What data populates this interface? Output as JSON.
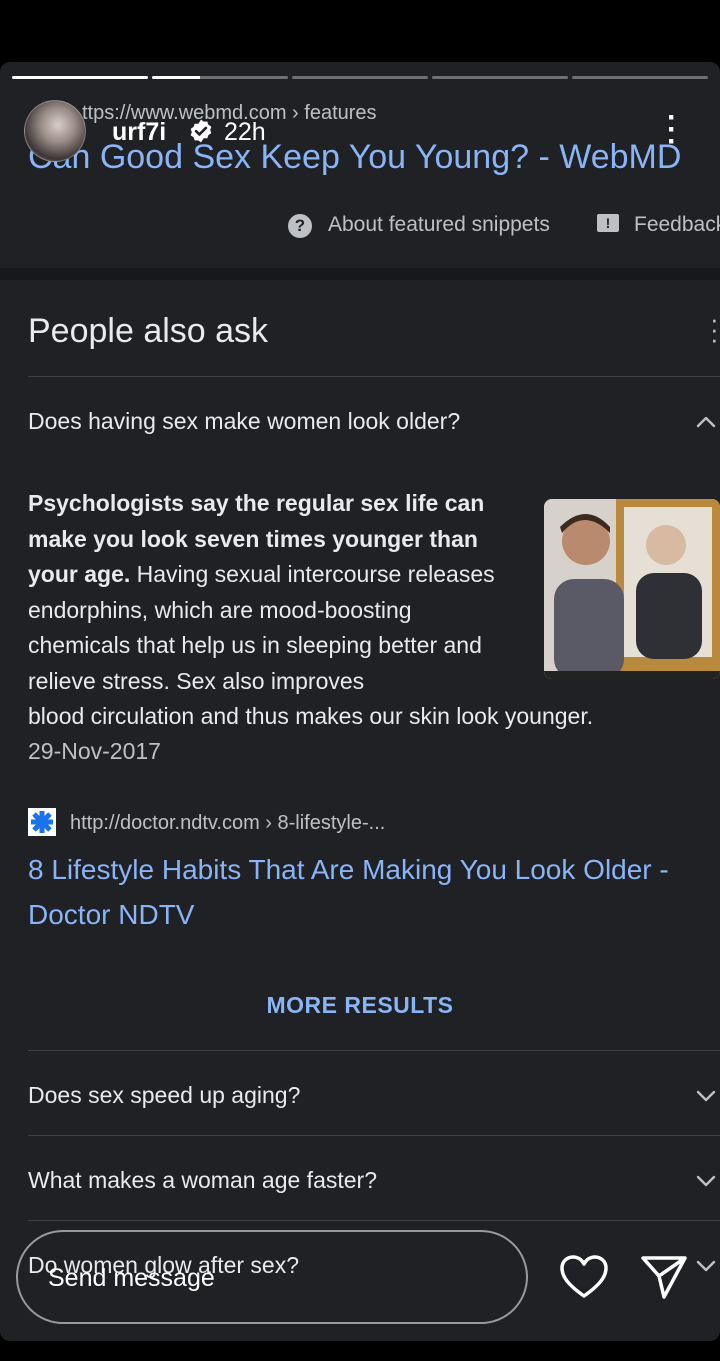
{
  "story": {
    "username": "urf7i",
    "time_ago": "22h",
    "progress": [
      1.0,
      0.35,
      0.0,
      0.0,
      0.0
    ],
    "reply_placeholder": "Send message"
  },
  "search": {
    "result_url": "ttps://www.webmd.com › features",
    "result_title": "Can Good Sex Keep You Young? - WebMD",
    "about_snippets": "About featured snippets",
    "feedback": "Feedback"
  },
  "paa": {
    "title": "People also ask",
    "expanded": {
      "question": "Does having sex make women look older?",
      "answer_bold": "Psychologists say the regular sex life can make you look seven times younger than your age.",
      "answer_rest": " Having sexual intercourse releases endorphins, which are mood-boosting chemicals that help us in sleeping better and relieve stress. Sex also improves",
      "answer_tail": "blood circulation and thus makes our skin look younger.",
      "date": "29-Nov-2017",
      "source_url": "http://doctor.ndtv.com › 8-lifestyle-...",
      "source_title": "8 Lifestyle Habits That Are Making You Look Older - Doctor NDTV"
    },
    "more_results": "MORE RESULTS",
    "questions": [
      "Does sex speed up aging?",
      "What makes a woman age faster?",
      "Do women glow after sex?"
    ]
  },
  "colors": {
    "background": "#202124",
    "link": "#8ab4f8",
    "text": "#e8eaed",
    "muted": "#bdc1c6"
  }
}
